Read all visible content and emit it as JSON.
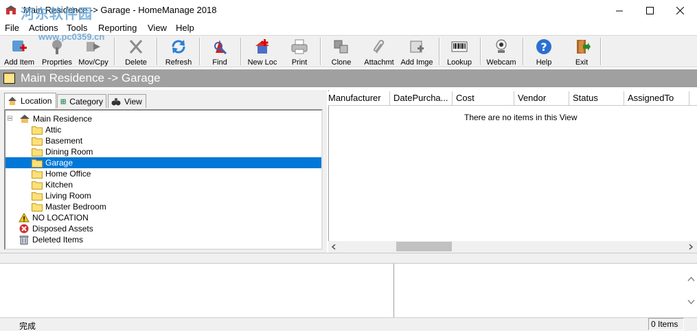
{
  "window": {
    "title": "Main Residence -> Garage - HomeManage 2018"
  },
  "menu": [
    "File",
    "Actions",
    "Tools",
    "Reporting",
    "View",
    "Help"
  ],
  "toolbar": [
    {
      "label": "Add Item",
      "icon": "add-item-icon"
    },
    {
      "label": "Proprties",
      "icon": "properties-icon"
    },
    {
      "label": "Mov/Cpy",
      "icon": "move-copy-icon"
    },
    {
      "label": "Delete",
      "icon": "delete-icon"
    },
    {
      "label": "Refresh",
      "icon": "refresh-icon"
    },
    {
      "label": "Find",
      "icon": "find-icon"
    },
    {
      "label": "New Loc",
      "icon": "new-location-icon"
    },
    {
      "label": "Print",
      "icon": "print-icon"
    },
    {
      "label": "Clone",
      "icon": "clone-icon"
    },
    {
      "label": "Attachmt",
      "icon": "attachment-icon"
    },
    {
      "label": "Add Imge",
      "icon": "add-image-icon"
    },
    {
      "label": "Lookup",
      "icon": "barcode-icon"
    },
    {
      "label": "Webcam",
      "icon": "webcam-icon"
    },
    {
      "label": "Help",
      "icon": "help-icon"
    },
    {
      "label": "Exit",
      "icon": "exit-icon"
    }
  ],
  "path_bar": "Main Residence -> Garage",
  "tabs": [
    "Location",
    "Category",
    "View"
  ],
  "tree": {
    "root": "Main Residence",
    "children": [
      "Attic",
      "Basement",
      "Dining Room",
      "Garage",
      "Home Office",
      "Kitchen",
      "Living Room",
      "Master Bedroom"
    ],
    "selected": "Garage",
    "extras": [
      "NO LOCATION",
      "Disposed Assets",
      "Deleted Items"
    ]
  },
  "columns": [
    "Manufacturer",
    "DatePurcha...",
    "Cost",
    "Vendor",
    "Status",
    "AssignedTo"
  ],
  "empty_message": "There are no items in this View",
  "status": {
    "text": "完成",
    "count": "0 Items"
  },
  "watermark": {
    "text": "河东软件园",
    "url": "www.pc0359.cn"
  },
  "colors": {
    "path_bar": "#a0a0a0",
    "selection": "#0078d7"
  }
}
